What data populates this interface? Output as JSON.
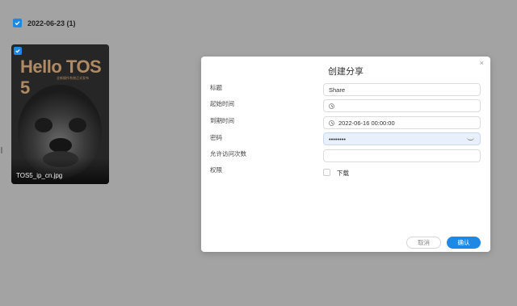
{
  "gallery": {
    "group_label": "2022-06-23 (1)",
    "thumb": {
      "title": "Hello TOS 5",
      "subtitle": "全新操作系统正式发布",
      "caption": "TOS5_ip_cn.jpg"
    }
  },
  "dialog": {
    "title": "创建分享",
    "close_glyph": "×",
    "labels": {
      "title": "标题",
      "start_time": "起始时间",
      "end_time": "到期时间",
      "password": "密码",
      "visit_count": "允许访问次数",
      "permission": "权限"
    },
    "fields": {
      "title_value": "Share",
      "start_time_value": "",
      "end_time_value": "2022-06-16 00:00:00",
      "password_value": "••••••••",
      "visit_count_value": ""
    },
    "permission_download": "下载",
    "buttons": {
      "cancel": "取消",
      "confirm": "确认"
    }
  },
  "colors": {
    "accent": "#1e88e5",
    "overlay": "#a3a3a3"
  },
  "icons": [
    "check-icon",
    "clock-icon",
    "eye-icon",
    "close-icon"
  ]
}
